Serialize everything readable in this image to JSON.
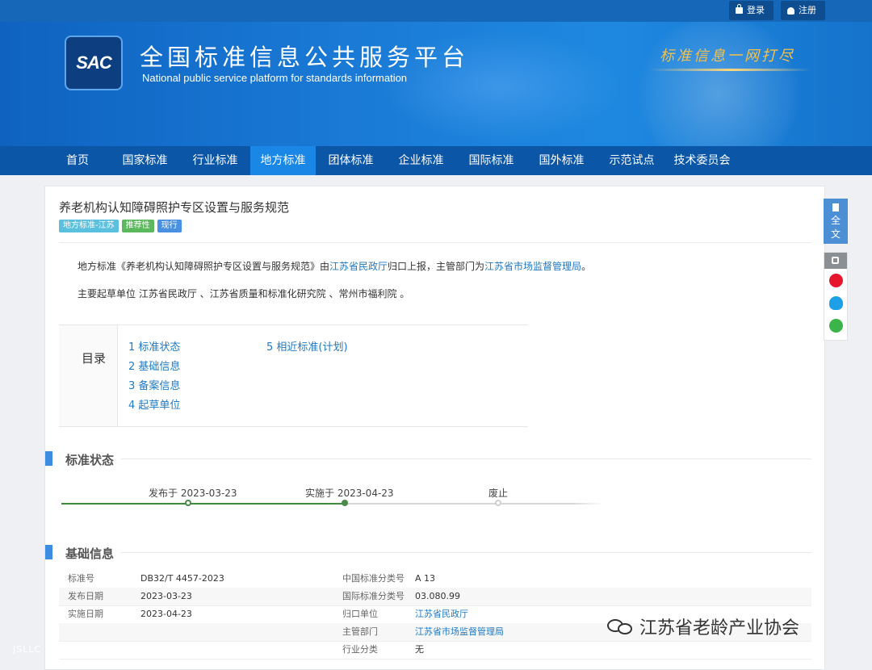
{
  "topbar": {
    "login_label": "登录",
    "register_label": "注册"
  },
  "header": {
    "logo_text": "SAC",
    "title_cn": "全国标准信息公共服务平台",
    "title_en": "National public service platform  for standards information",
    "slogan": "标准信息一网打尽"
  },
  "nav": {
    "items": [
      {
        "label": "首页"
      },
      {
        "label": "国家标准"
      },
      {
        "label": "行业标准"
      },
      {
        "label": "地方标准"
      },
      {
        "label": "团体标准"
      },
      {
        "label": "企业标准"
      },
      {
        "label": "国际标准"
      },
      {
        "label": "国外标准"
      },
      {
        "label": "示范试点"
      },
      {
        "label": "技术委员会"
      }
    ],
    "active_index": 3
  },
  "document": {
    "title": "养老机构认知障碍照护专区设置与服务规范",
    "badges": [
      {
        "label": "地方标准-江苏",
        "color": "#5bc0de"
      },
      {
        "label": "推荐性",
        "color": "#5cb85c"
      },
      {
        "label": "现行",
        "color": "#4a90e2"
      }
    ],
    "intro": {
      "p1_prefix": "地方标准《养老机构认知障碍照护专区设置与服务规范》由",
      "p1_link1": "江苏省民政厅",
      "p1_middle": "归口上报，主管部门为",
      "p1_link2": "江苏省市场监督管理局",
      "p1_suffix": "。",
      "p2": "主要起草单位 江苏省民政厅 、江苏省质量和标准化研究院 、常州市福利院 。"
    }
  },
  "toc": {
    "heading": "目录",
    "items": [
      {
        "label": "1  标准状态"
      },
      {
        "label": "2  基础信息"
      },
      {
        "label": "3  备案信息"
      },
      {
        "label": "4  起草单位"
      },
      {
        "label": "5  相近标准(计划)"
      }
    ]
  },
  "status_section": {
    "title": "标准状态",
    "steps": [
      {
        "label": "发布于 2023-03-23"
      },
      {
        "label": "实施于 2023-04-23"
      },
      {
        "label": "废止"
      }
    ]
  },
  "basic_section": {
    "title": "基础信息",
    "rows": [
      {
        "l1": "标准号",
        "v1": "DB32/T 4457-2023",
        "l2": "中国标准分类号",
        "v2": "A 13",
        "v2_link": false
      },
      {
        "l1": "发布日期",
        "v1": "2023-03-23",
        "l2": "国际标准分类号",
        "v2": "03.080.99",
        "v2_link": false
      },
      {
        "l1": "实施日期",
        "v1": "2023-04-23",
        "l2": "归口单位",
        "v2": "江苏省民政厅",
        "v2_link": true
      },
      {
        "l1": "",
        "v1": "",
        "l2": "主管部门",
        "v2": "江苏省市场监督管理局",
        "v2_link": true
      },
      {
        "l1": "",
        "v1": "",
        "l2": "行业分类",
        "v2": "无",
        "v2_link": false
      }
    ]
  },
  "side_tools": {
    "fulltext_label": "全文",
    "icons": [
      "share-icon",
      "weibo-icon",
      "qq-icon",
      "wechat-icon"
    ]
  },
  "watermark": {
    "text": "江苏省老龄产业协会",
    "corner_text": "JSLLC"
  }
}
